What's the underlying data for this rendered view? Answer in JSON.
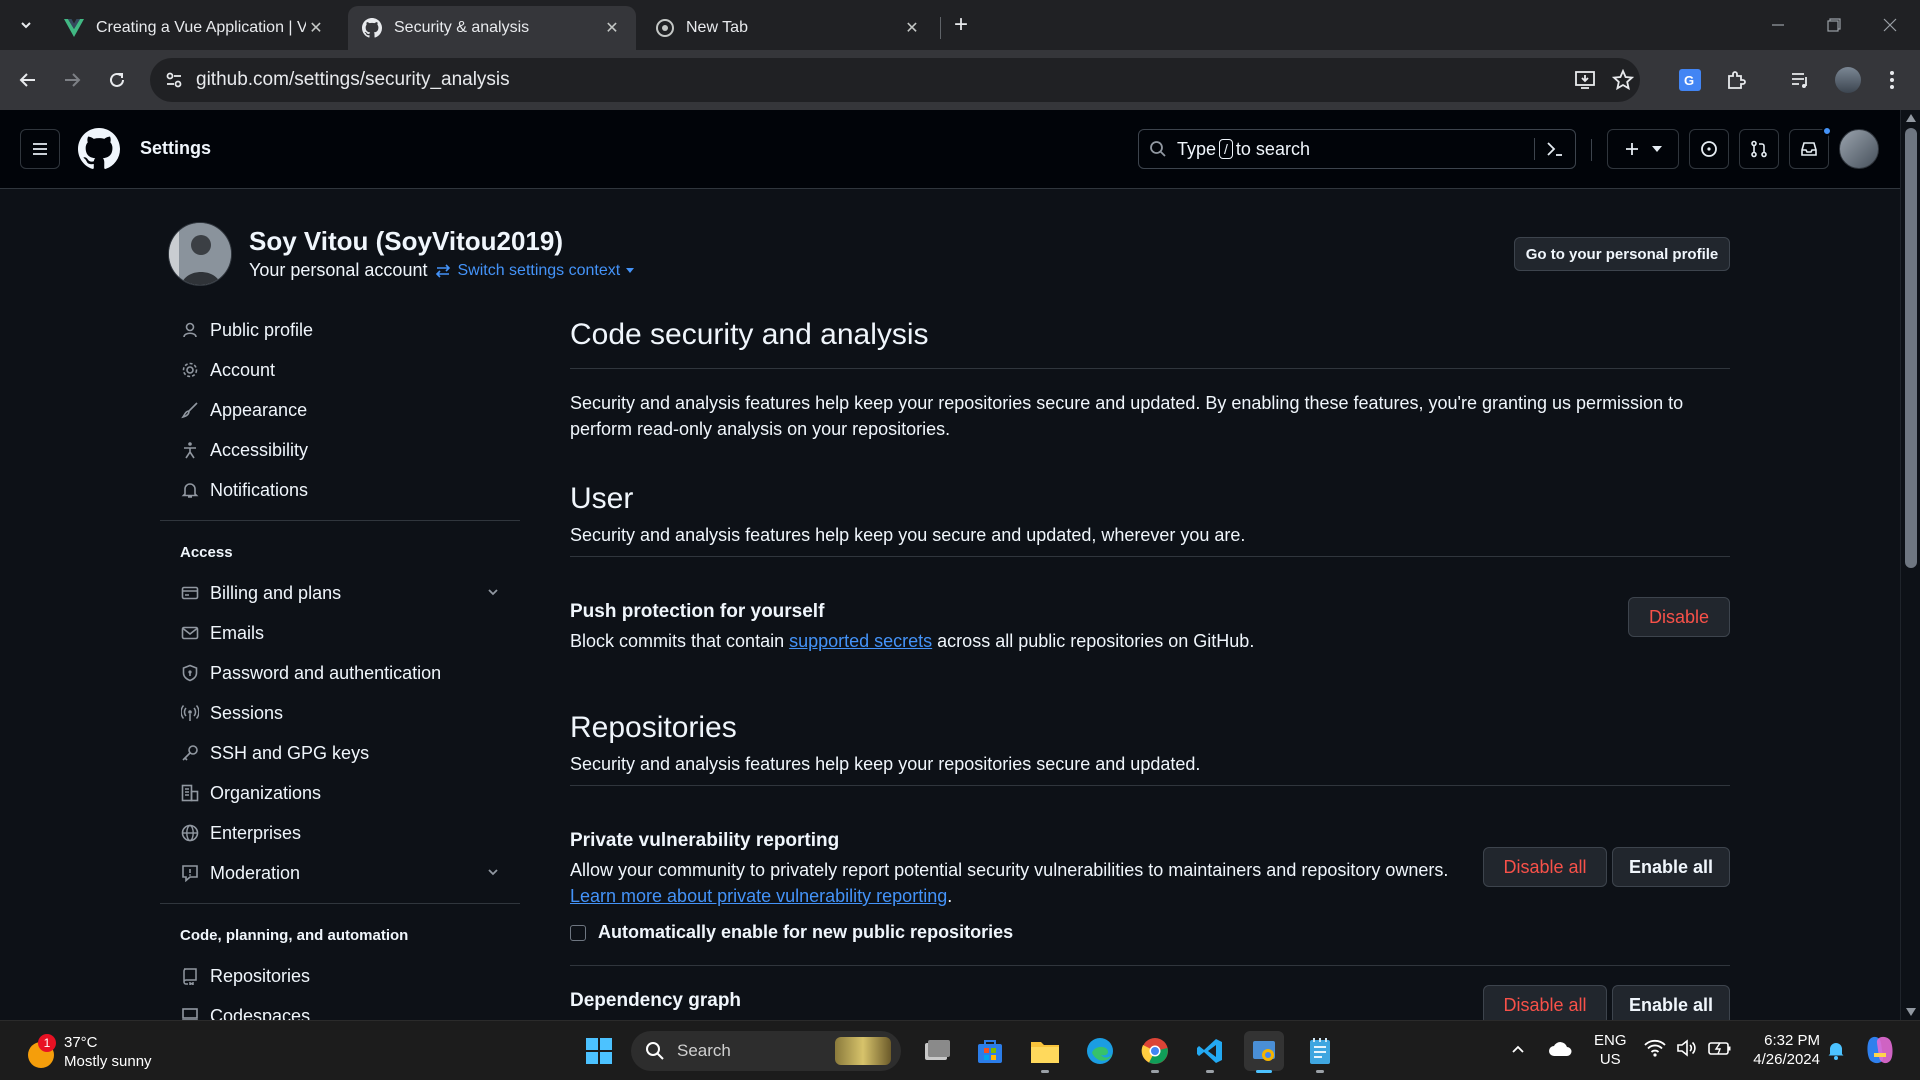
{
  "browser": {
    "tabs": [
      {
        "title": "Creating a Vue Application | Vue",
        "icon": "vue-logo-icon",
        "active": false
      },
      {
        "title": "Security & analysis",
        "icon": "github-logo-icon",
        "active": true
      },
      {
        "title": "New Tab",
        "icon": "chrome-logo-icon",
        "active": false
      }
    ],
    "url": "github.com/settings/security_analysis"
  },
  "header": {
    "title": "Settings",
    "search_prefix": "Type",
    "search_key": "/",
    "search_suffix": "to search"
  },
  "profile": {
    "name": "Soy Vitou (SoyVitou2019)",
    "subtitle": "Your personal account",
    "switch_label": "Switch settings context",
    "go_profile_label": "Go to your personal profile"
  },
  "sidebar": {
    "items_top": [
      {
        "label": "Public profile",
        "icon": "person-icon"
      },
      {
        "label": "Account",
        "icon": "gear-icon"
      },
      {
        "label": "Appearance",
        "icon": "paintbrush-icon"
      },
      {
        "label": "Accessibility",
        "icon": "accessibility-icon"
      },
      {
        "label": "Notifications",
        "icon": "bell-icon"
      }
    ],
    "access_heading": "Access",
    "items_access": [
      {
        "label": "Billing and plans",
        "icon": "credit-card-icon"
      },
      {
        "label": "Emails",
        "icon": "mail-icon"
      },
      {
        "label": "Password and authentication",
        "icon": "shield-lock-icon"
      },
      {
        "label": "Sessions",
        "icon": "broadcast-icon"
      },
      {
        "label": "SSH and GPG keys",
        "icon": "key-icon"
      },
      {
        "label": "Organizations",
        "icon": "organization-icon"
      },
      {
        "label": "Enterprises",
        "icon": "globe-icon"
      },
      {
        "label": "Moderation",
        "icon": "report-icon"
      }
    ],
    "code_heading": "Code, planning, and automation",
    "items_code": [
      {
        "label": "Repositories",
        "icon": "repo-icon"
      },
      {
        "label": "Codespaces",
        "icon": "codespaces-icon"
      }
    ]
  },
  "main": {
    "title": "Code security and analysis",
    "intro": "Security and analysis features help keep your repositories secure and updated. By enabling these features, you're granting us permission to perform read-only analysis on your repositories.",
    "user_heading": "User",
    "user_desc": "Security and analysis features help keep you secure and updated, wherever you are.",
    "push_title": "Push protection for yourself",
    "push_desc_before": "Block commits that contain ",
    "push_desc_link": "supported secrets",
    "push_desc_after": " across all public repositories on GitHub.",
    "push_button": "Disable",
    "repos_heading": "Repositories",
    "repos_desc": "Security and analysis features help keep your repositories secure and updated.",
    "pvr_title": "Private vulnerability reporting",
    "pvr_desc": "Allow your community to privately report potential security vulnerabilities to maintainers and repository owners.",
    "pvr_link": "Learn more about private vulnerability reporting",
    "pvr_link_suffix": ".",
    "pvr_checkbox_label": "Automatically enable for new public repositories",
    "disable_all": "Disable all",
    "enable_all": "Enable all",
    "dep_title": "Dependency graph"
  },
  "taskbar": {
    "weather_temp": "37°C",
    "weather_desc": "Mostly sunny",
    "weather_badge": "1",
    "search_label": "Search",
    "lang_top": "ENG",
    "lang_bottom": "US",
    "time": "6:32 PM",
    "date": "4/26/2024"
  },
  "colors": {
    "accent": "#4493f8",
    "danger": "#f85149",
    "background": "#0d1117",
    "header": "#010409"
  }
}
